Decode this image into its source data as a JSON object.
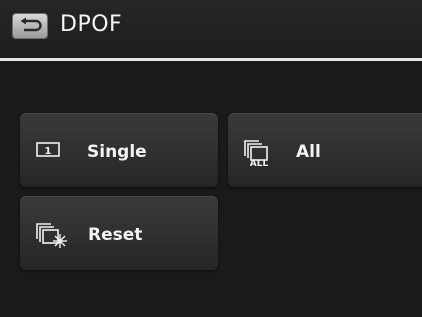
{
  "header": {
    "title": "DPOF",
    "back_icon": "return-arrow-icon"
  },
  "menu": {
    "items": [
      {
        "label": "Single",
        "icon": "single-frame-1-icon",
        "icon_text": "1"
      },
      {
        "label": "All",
        "icon": "all-images-stack-icon",
        "icon_text": "ALL"
      },
      {
        "label": "Reset",
        "icon": "reset-stack-sparkle-icon"
      }
    ]
  }
}
